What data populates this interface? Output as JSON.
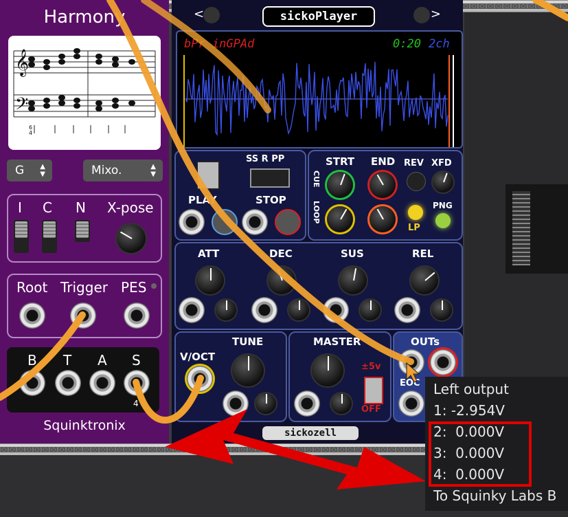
{
  "harmony": {
    "title": "Harmony",
    "key_select": "G",
    "mode_select": "Mixo.",
    "switch_labels": [
      "I",
      "C",
      "N",
      "X-pose"
    ],
    "jack_labels": [
      "Root",
      "Trigger",
      "PES"
    ],
    "output_labels": [
      "B",
      "T",
      "A",
      "S"
    ],
    "output_count": "4",
    "brand": "Squinktronix",
    "time_sig": "6\n4"
  },
  "sicko": {
    "title": "sickoPlayer",
    "nav_left": "<",
    "nav_right": ">",
    "display_left": "bPr inGPAd",
    "display_time": "0:20",
    "display_channels": "2ch",
    "play_section": {
      "ss_label": "SS R PP",
      "play": "PLAY",
      "stop": "STOP"
    },
    "cue_section": {
      "cue": "CUE",
      "loop": "LOOP",
      "strt": "STRT",
      "end": "END",
      "rev": "REV",
      "xfd": "XFD",
      "lp": "LP",
      "png": "PNG"
    },
    "env_section": {
      "att": "ATT",
      "dec": "DEC",
      "sus": "SUS",
      "rel": "REL"
    },
    "pitch_section": {
      "voct": "V/OCT",
      "tune": "TUNE"
    },
    "master_section": {
      "master": "MASTER",
      "range": "±5v",
      "off": "OFF"
    },
    "outs_section": {
      "outs": "OUTs",
      "eoc": "EOC"
    },
    "brand": "sickozell"
  },
  "tooltip": {
    "title": "Left output",
    "lines": [
      "1: -2.954V",
      "2:  0.000V",
      "3:  0.000V",
      "4:  0.000V"
    ],
    "footer": "To Squinky Labs B"
  },
  "colors": {
    "harmony_bg": "#5a0f66",
    "sicko_bg": "#0f0f2c",
    "cable": "#f0a030",
    "arrow": "#e00000",
    "waveform": "#3a50e8"
  }
}
